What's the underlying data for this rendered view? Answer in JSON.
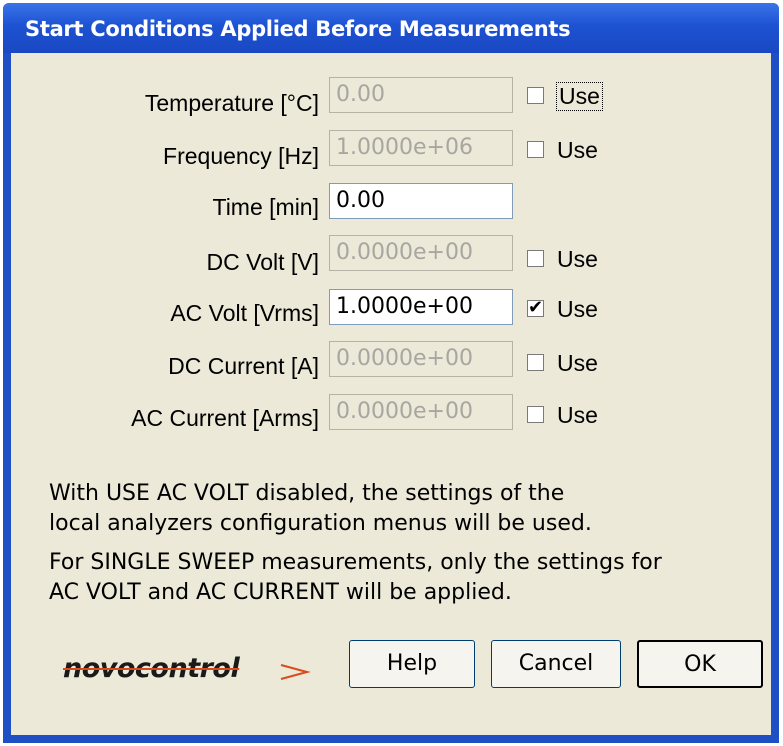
{
  "window": {
    "title": "Start Conditions Applied Before Measurements"
  },
  "rows": [
    {
      "label": "Temperature [°C]",
      "value": "0.00",
      "enabled": false,
      "has_use": true,
      "use_checked": false,
      "use_label": "Use"
    },
    {
      "label": "Frequency [Hz]",
      "value": "1.0000e+06",
      "enabled": false,
      "has_use": true,
      "use_checked": false,
      "use_label": "Use"
    },
    {
      "label": "Time [min]",
      "value": "0.00",
      "enabled": true,
      "has_use": false
    },
    {
      "label": "DC Volt [V]",
      "value": "0.0000e+00",
      "enabled": false,
      "has_use": true,
      "use_checked": false,
      "use_label": "Use"
    },
    {
      "label": "AC Volt [Vrms]",
      "value": "1.0000e+00",
      "enabled": true,
      "has_use": true,
      "use_checked": true,
      "use_label": "Use"
    },
    {
      "label": "DC Current [A]",
      "value": "0.0000e+00",
      "enabled": false,
      "has_use": true,
      "use_checked": false,
      "use_label": "Use"
    },
    {
      "label": "AC Current [Arms]",
      "value": "0.0000e+00",
      "enabled": false,
      "has_use": true,
      "use_checked": false,
      "use_label": "Use"
    }
  ],
  "info": {
    "line1": "With USE AC VOLT disabled, the settings of the",
    "line2": "local analyzers configuration menus will be used.",
    "line3": "For SINGLE SWEEP measurements, only the settings for",
    "line4": "AC VOLT and AC CURRENT will be applied."
  },
  "logo": {
    "text": "novocontrol"
  },
  "buttons": {
    "help": "Help",
    "cancel": "Cancel",
    "ok": "OK"
  },
  "colors": {
    "titlebar": "#1d52d2",
    "dialog_bg": "#ece9d8",
    "logo_accent": "#d84b1c"
  }
}
